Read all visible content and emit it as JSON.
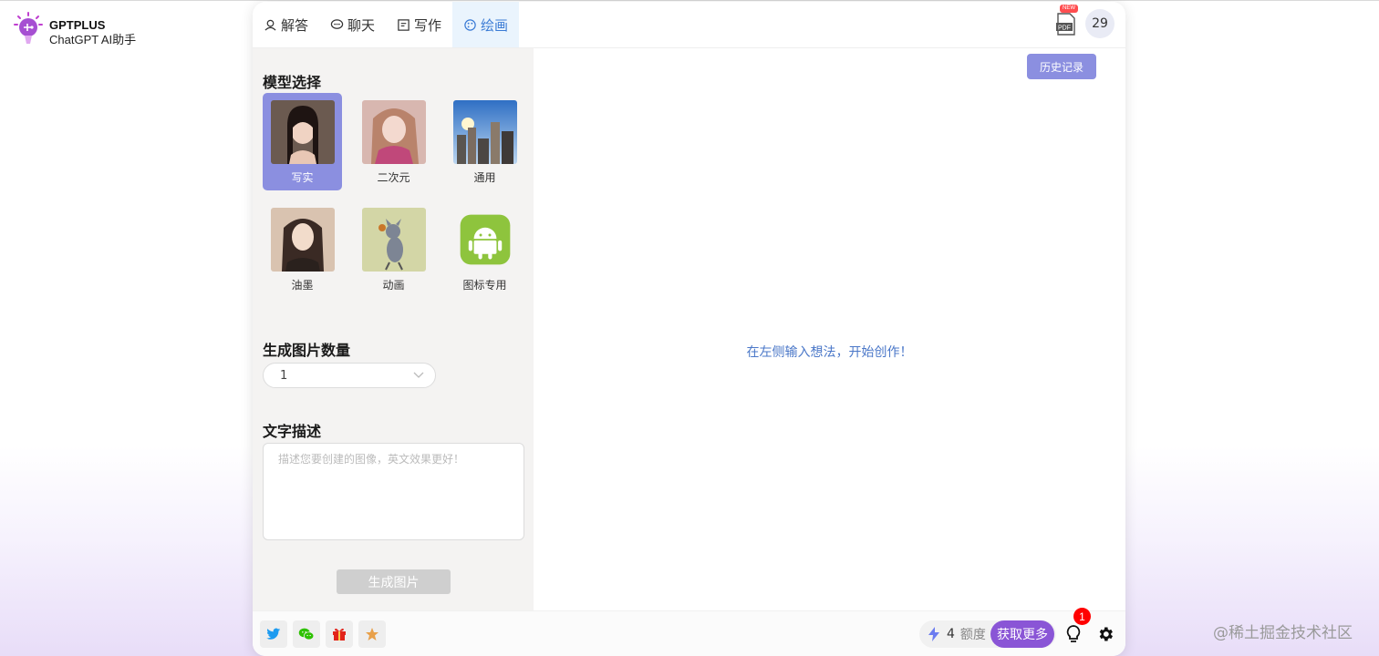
{
  "brand": {
    "name": "GPTPLUS",
    "subtitle": "ChatGPT AI助手",
    "icon": "lightbulb-logo-icon"
  },
  "tabs": [
    {
      "label": "解答",
      "icon": "qa-icon"
    },
    {
      "label": "聊天",
      "icon": "chat-bubble-icon"
    },
    {
      "label": "写作",
      "icon": "edit-icon"
    },
    {
      "label": "绘画",
      "icon": "palette-icon",
      "active": true
    }
  ],
  "header": {
    "pdf_new_badge": "NEW",
    "pdf_text": "PDF",
    "count": "29"
  },
  "left": {
    "model_title": "模型选择",
    "models": [
      {
        "label": "写实",
        "selected": true
      },
      {
        "label": "二次元"
      },
      {
        "label": "通用"
      },
      {
        "label": "油墨"
      },
      {
        "label": "动画"
      },
      {
        "label": "图标专用"
      }
    ],
    "count_title": "生成图片数量",
    "count_value": "1",
    "desc_title": "文字描述",
    "desc_placeholder": "描述您要创建的图像，英文效果更好！",
    "generate_label": "生成图片"
  },
  "right": {
    "history_label": "历史记录",
    "hint": "在左侧输入想法，开始创作！"
  },
  "footer": {
    "quota_value": "4",
    "quota_label": "额度",
    "get_more": "获取更多",
    "notification_count": "1"
  },
  "watermark": "@稀土掘金技术社区",
  "colors": {
    "accent": "#8b8fe0",
    "purple": "#8a55d6",
    "hint": "#4a77c8",
    "active_tab_bg": "#eaf4fd"
  }
}
